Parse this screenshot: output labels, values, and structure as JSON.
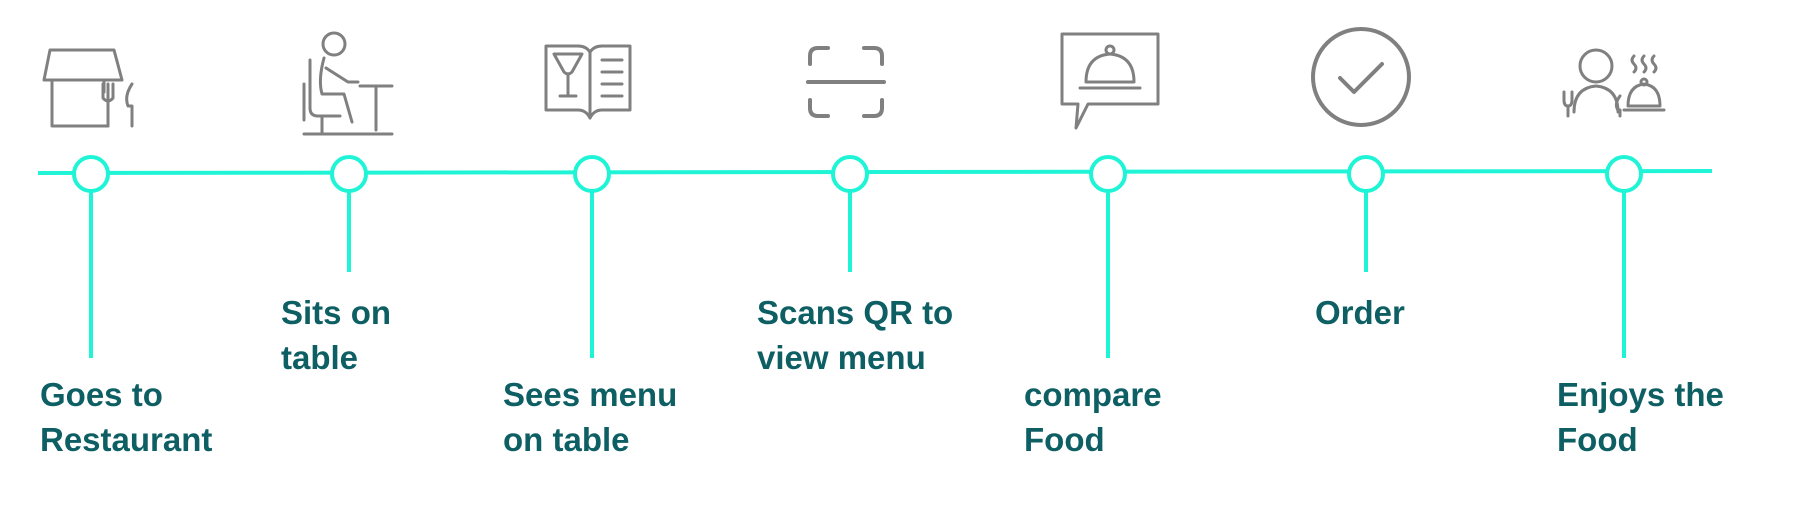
{
  "colors": {
    "timeline": "#1ff5d6",
    "icon": "#808080",
    "label": "#0e5f63",
    "background": "#ffffff"
  },
  "steps": [
    {
      "icon": "restaurant-icon",
      "lines": [
        "Goes to",
        "Restaurant"
      ]
    },
    {
      "icon": "person-sitting-at-table-icon",
      "lines": [
        "Sits on",
        "table"
      ]
    },
    {
      "icon": "menu-book-icon",
      "lines": [
        "Sees menu",
        "on table"
      ]
    },
    {
      "icon": "qr-scan-frame-icon",
      "lines": [
        "Scans QR to",
        "view menu"
      ]
    },
    {
      "icon": "food-cloche-chat-icon",
      "lines": [
        "compare",
        "Food"
      ]
    },
    {
      "icon": "check-circle-icon",
      "lines": [
        "Order"
      ]
    },
    {
      "icon": "diner-with-food-icon",
      "lines": [
        "Enjoys the",
        "Food"
      ]
    }
  ]
}
